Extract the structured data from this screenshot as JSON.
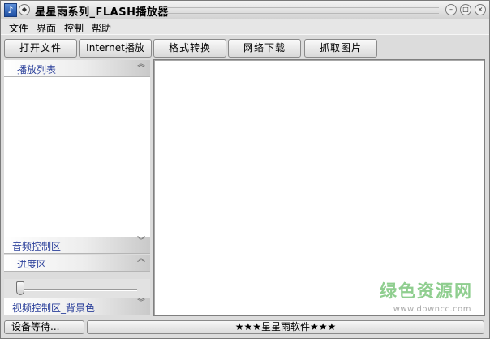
{
  "window": {
    "title": "星星雨系列_FLASH播放器",
    "icon_glyph": "♪",
    "sysmenu_glyph": "◆",
    "controls": {
      "minimize": "–",
      "restore": "□",
      "close": "×"
    }
  },
  "menubar": {
    "items": [
      "文件",
      "界面",
      "控制",
      "帮助"
    ]
  },
  "toolbar": {
    "buttons": [
      "打开文件",
      "Internet播放",
      "格式转换",
      "网络下载",
      "抓取图片"
    ]
  },
  "left_panel": {
    "playlist": {
      "title": "播放列表",
      "chevron": "︽"
    },
    "audio": {
      "title": "音频控制区",
      "chevron": "︾"
    },
    "progress": {
      "title": "进度区",
      "chevron": "︽",
      "value": 0
    },
    "video": {
      "title": "视频控制区_背景色",
      "chevron": "︾"
    }
  },
  "watermark": {
    "main": "绿色资源网",
    "sub": "www.downcc.com"
  },
  "statusbar": {
    "left": "设备等待...",
    "right": "★★★星星雨软件★★★"
  },
  "colors": {
    "section_title": "#2a3f9a",
    "watermark": "#8fce8f"
  }
}
